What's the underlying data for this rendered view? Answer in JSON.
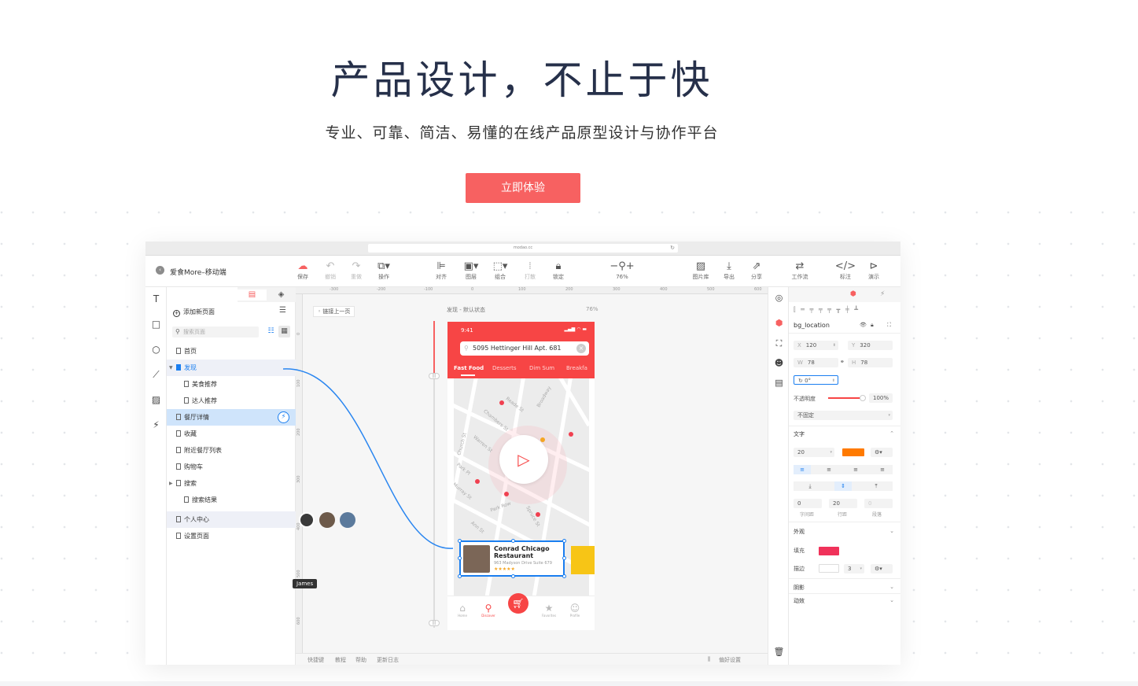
{
  "hero": {
    "title": "产品设计，不止于快",
    "subtitle": "专业、可靠、简洁、易懂的在线产品原型设计与协作平台",
    "cta_label": "立即体验"
  },
  "browser": {
    "url": "modao.cc"
  },
  "project": {
    "name": "爱食More–移动端"
  },
  "toolbar": {
    "save": "保存",
    "undo": "撤销",
    "redo": "重做",
    "action": "操作",
    "align": "对齐",
    "layer": "图层",
    "group": "组合",
    "break": "打散",
    "lock": "锁定",
    "zoom": "76%",
    "library": "图片库",
    "export": "导出",
    "share": "分享",
    "workflow": "工作流",
    "annotate": "标注",
    "demo": "演示"
  },
  "pages_panel": {
    "add_page": "添加新页面",
    "search_placeholder": "搜索页面",
    "items": [
      {
        "label": "首页"
      },
      {
        "label": "发现"
      },
      {
        "label": "美食推荐"
      },
      {
        "label": "达人推荐"
      },
      {
        "label": "餐厅详情"
      },
      {
        "label": "收藏"
      },
      {
        "label": "附近餐厅列表"
      },
      {
        "label": "购物车"
      },
      {
        "label": "搜索"
      },
      {
        "label": "搜索结果"
      },
      {
        "label": "个人中心"
      },
      {
        "label": "设置页面"
      }
    ]
  },
  "canvas": {
    "ruler_h": [
      "-300",
      "-200",
      "-100",
      "0",
      "100",
      "200",
      "300",
      "400",
      "500",
      "600"
    ],
    "ruler_v": [
      "0",
      "100",
      "200",
      "300",
      "400",
      "500",
      "600"
    ],
    "link_prev": "链接上一页",
    "artboard_label": "发现 - 默认状态",
    "artboard_zoom": "76%",
    "collaborator_tip": "James",
    "footer": {
      "shortcuts": "快捷键",
      "tutorial": "教程",
      "help": "帮助",
      "changelog": "更新日志",
      "prefs": "偏好设置"
    }
  },
  "phone": {
    "time": "9:41",
    "address": "5095 Hettinger Hill Apt. 681",
    "categories": [
      "Fast Food",
      "Desserts",
      "Dim Sum",
      "Breakfa"
    ],
    "streets": [
      "Reade St",
      "Chambers St",
      "Warren St",
      "Church St",
      "Park Pl",
      "Murray St",
      "Park Row",
      "Spruce St",
      "Ann St",
      "Broadway"
    ],
    "card": {
      "name": "Conrad Chicago Restaurant",
      "address": "963 Madyson Drive Suite 679",
      "stars": "★★★★★"
    },
    "tabs": [
      "Home",
      "Discover",
      "Favorites",
      "Profile"
    ]
  },
  "props": {
    "layer_name": "bg_location",
    "x_label": "X",
    "x": "120",
    "y_label": "Y",
    "y": "320",
    "w_label": "W",
    "w": "78",
    "h_label": "H",
    "h": "78",
    "rotation": "0°",
    "opacity_label": "不透明度",
    "opacity": "100%",
    "fixed": "不固定",
    "text_section": "文字",
    "font_size": "20",
    "text_color": "#ff7a00",
    "letter_spacing": "0",
    "letter_spacing_label": "字间距",
    "line_height": "20",
    "line_height_label": "行距",
    "paragraph": "0",
    "paragraph_label": "段落",
    "appearance_section": "外观",
    "fill_label": "填充",
    "fill_color": "#f0325a",
    "stroke_label": "描边",
    "stroke_width": "3",
    "shadow_section": "阴影",
    "animation_section": "动效"
  }
}
